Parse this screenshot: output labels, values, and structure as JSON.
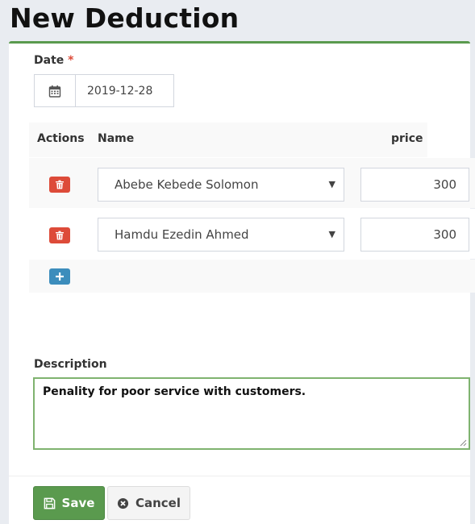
{
  "page": {
    "title": "New Deduction"
  },
  "form": {
    "date_label": "Date",
    "required_mark": "*",
    "date_value": "2019-12-28",
    "table": {
      "headers": {
        "actions": "Actions",
        "name": "Name",
        "price": "price"
      },
      "rows": [
        {
          "name": "Abebe Kebede Solomon",
          "price": "300"
        },
        {
          "name": "Hamdu Ezedin Ahmed",
          "price": "300"
        }
      ]
    },
    "description_label": "Description",
    "description_value": "Penality for poor service with customers.",
    "buttons": {
      "save": "Save",
      "cancel": "Cancel"
    }
  },
  "icons": {
    "date": "calendar-icon",
    "delete": "trash-icon",
    "add": "plus-icon",
    "save": "floppy-disk-icon",
    "cancel": "times-circle-icon",
    "select": "caret-down-icon"
  },
  "colors": {
    "accent": "#5a9a4e",
    "danger": "#dd4b39",
    "primary": "#3c8dbc",
    "required": "#dd4b39"
  }
}
